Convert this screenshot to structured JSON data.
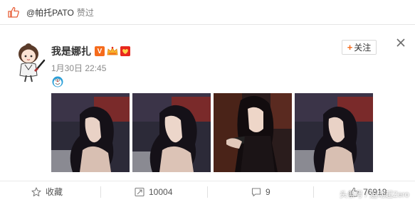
{
  "like_bar": {
    "user": "@帕托PATO",
    "action": "赞过"
  },
  "post": {
    "author": "我是娜扎",
    "time": "1月30日 22:45",
    "follow_label": "关注",
    "badges": [
      "V"
    ],
    "colors": {
      "brand": "#f56b1c",
      "badge_red": "#e8281e"
    }
  },
  "actions": {
    "favorite_label": "收藏",
    "repost_count": "10004",
    "comment_count": "9",
    "like_count": "76919"
  },
  "watermark": "头条号 / 运动起Zero"
}
